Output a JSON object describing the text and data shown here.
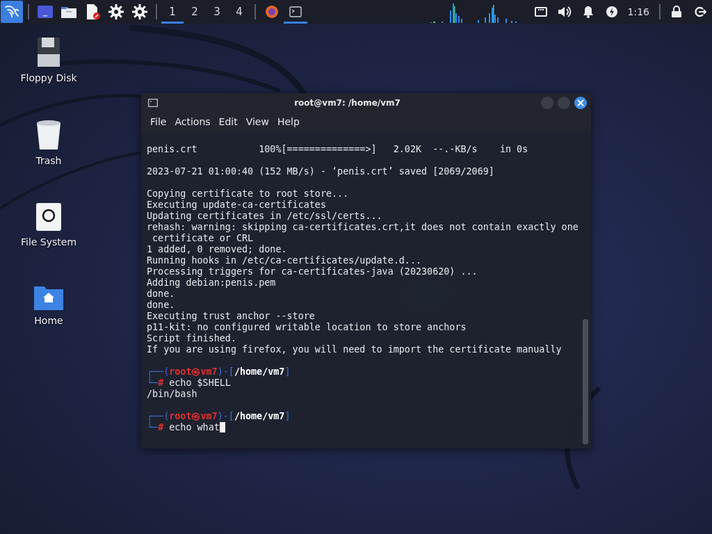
{
  "taskbar": {
    "launchers": [
      {
        "kind": "app-menu",
        "selected": true
      },
      {
        "kind": "screen",
        "selected": false
      },
      {
        "kind": "folder",
        "selected": false
      },
      {
        "kind": "editor",
        "selected": false
      },
      {
        "kind": "settings",
        "selected": false
      },
      {
        "kind": "settings",
        "selected": false
      }
    ],
    "workspaces": [
      {
        "label": "1",
        "selected": true
      },
      {
        "label": "2",
        "selected": false
      },
      {
        "label": "3",
        "selected": false
      },
      {
        "label": "4",
        "selected": false
      }
    ],
    "tasks": [
      {
        "kind": "browser",
        "selected": false
      },
      {
        "kind": "terminal",
        "selected": true
      }
    ],
    "tray": [
      {
        "kind": "network"
      },
      {
        "kind": "volume"
      },
      {
        "kind": "bell"
      },
      {
        "kind": "power"
      }
    ],
    "clock": "1:16",
    "end": [
      {
        "kind": "lock"
      },
      {
        "kind": "logout"
      }
    ]
  },
  "desktop_icons": [
    {
      "label": "Floppy Disk",
      "kind": "floppy"
    },
    {
      "label": "Trash",
      "kind": "trash"
    },
    {
      "label": "File System",
      "kind": "drive"
    },
    {
      "label": "Home",
      "kind": "home"
    }
  ],
  "window": {
    "title": "root@vm7: /home/vm7",
    "menu": [
      "File",
      "Actions",
      "Edit",
      "View",
      "Help"
    ],
    "lines": [
      {
        "kind": "text",
        "text": "penis.crt           100%[==============>]   2.02K  --.-KB/s    in 0s"
      },
      {
        "kind": "blank"
      },
      {
        "kind": "text",
        "text": "2023-07-21 01:00:40 (152 MB/s) - ‘penis.crt’ saved [2069/2069]"
      },
      {
        "kind": "blank"
      },
      {
        "kind": "text",
        "text": "Copying certificate to root store..."
      },
      {
        "kind": "text",
        "text": "Executing update-ca-certificates"
      },
      {
        "kind": "text",
        "text": "Updating certificates in /etc/ssl/certs..."
      },
      {
        "kind": "text",
        "text": "rehash: warning: skipping ca-certificates.crt,it does not contain exactly one"
      },
      {
        "kind": "text",
        "text": " certificate or CRL"
      },
      {
        "kind": "text",
        "text": "1 added, 0 removed; done."
      },
      {
        "kind": "text",
        "text": "Running hooks in /etc/ca-certificates/update.d..."
      },
      {
        "kind": "text",
        "text": "Processing triggers for ca-certificates-java (20230620) ..."
      },
      {
        "kind": "text",
        "text": "Adding debian:penis.pem"
      },
      {
        "kind": "text",
        "text": "done."
      },
      {
        "kind": "text",
        "text": "done."
      },
      {
        "kind": "text",
        "text": "Executing trust anchor --store"
      },
      {
        "kind": "text",
        "text": "p11-kit: no configured writable location to store anchors"
      },
      {
        "kind": "text",
        "text": "Script finished."
      },
      {
        "kind": "text",
        "text": "If you are using firefox, you will need to import the certificate manually"
      },
      {
        "kind": "blank"
      },
      {
        "kind": "prompt",
        "open": "┌──(",
        "user_host": "root㉿vm7",
        "mid": ")-[",
        "path": "/home/vm7",
        "close": "]"
      },
      {
        "kind": "command",
        "corner": "└─",
        "mark": "#",
        "command": "echo $SHELL",
        "cursor": false
      },
      {
        "kind": "text",
        "text": "/bin/bash"
      },
      {
        "kind": "blank"
      },
      {
        "kind": "prompt",
        "open": "┌──(",
        "user_host": "root㉿vm7",
        "mid": ")-[",
        "path": "/home/vm7",
        "close": "]"
      },
      {
        "kind": "command",
        "corner": "└─",
        "mark": "#",
        "command": "echo what",
        "cursor": true
      }
    ]
  }
}
